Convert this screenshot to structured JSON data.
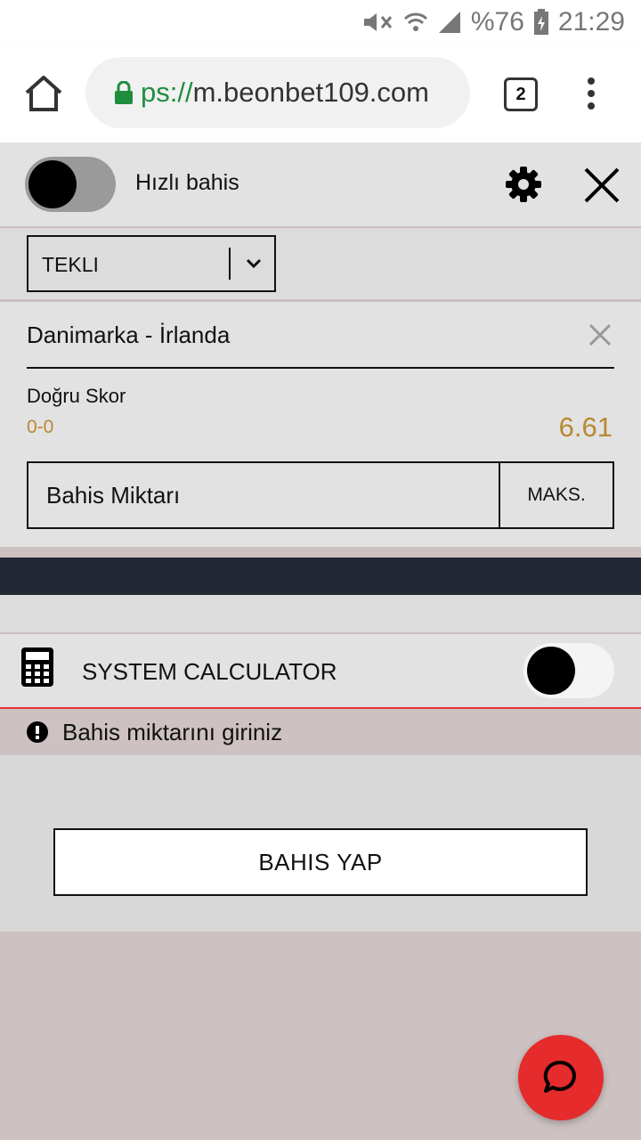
{
  "status_bar": {
    "battery": "%76",
    "time": "21:29"
  },
  "browser": {
    "url_scheme": "ps://",
    "url_host": "m.beonbet109.com",
    "tab_count": "2"
  },
  "betslip": {
    "quick_bet_label": "Hızlı bahis",
    "quick_bet_on": false,
    "bet_type": "TEKLI",
    "match": "Danimarka - İrlanda",
    "market": "Doğru Skor",
    "selection": "0-0",
    "odds": "6.61",
    "stake_placeholder": "Bahis Miktarı",
    "max_label": "MAKS.",
    "system_calculator_label": "SYSTEM CALCULATOR",
    "system_calculator_on": false,
    "warning": "Bahis miktarını giriniz",
    "place_bet_label": "BAHIS YAP"
  },
  "colors": {
    "accent_odds": "#b8892f",
    "error": "#e8333a",
    "chat": "#e52b2b",
    "dark_band": "#232733"
  }
}
